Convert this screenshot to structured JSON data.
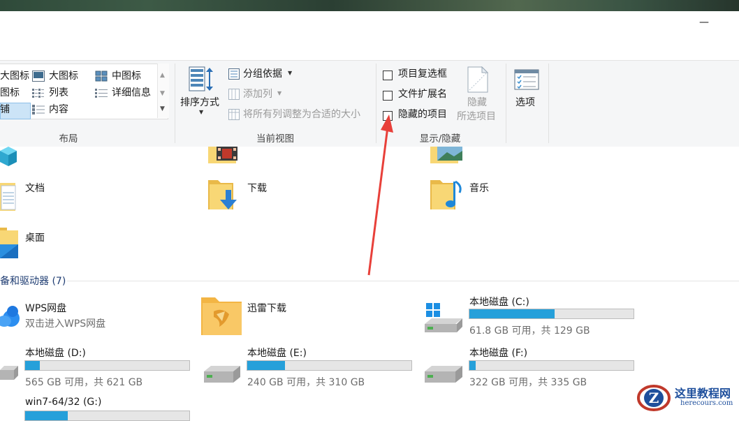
{
  "window": {
    "minimize_glyph": "—"
  },
  "ribbon": {
    "layout": {
      "label": "布局",
      "items": [
        "大图标",
        "大图标",
        "中图标",
        "图标",
        "列表",
        "详细信息",
        "铺",
        "内容"
      ]
    },
    "current_view": {
      "label": "当前视图",
      "sort_by": "排序方式",
      "group_by": "分组依据",
      "add_column": "添加列",
      "fit_columns": "将所有列调整为合适的大小"
    },
    "show_hide": {
      "label": "显示/隐藏",
      "checkboxes": [
        {
          "label": "项目复选框",
          "checked": false
        },
        {
          "label": "文件扩展名",
          "checked": false
        },
        {
          "label": "隐藏的项目",
          "checked": false
        }
      ],
      "hide_selected_line1": "隐藏",
      "hide_selected_line2": "所选项目"
    },
    "options": {
      "label": "选项"
    }
  },
  "folders": [
    {
      "name": "文档",
      "icon": "document-folder-icon"
    },
    {
      "name": "下载",
      "icon": "download-folder-icon"
    },
    {
      "name": "音乐",
      "icon": "music-folder-icon"
    },
    {
      "name": "桌面",
      "icon": "desktop-folder-icon"
    }
  ],
  "devices": {
    "header": "备和驱动器 (7)",
    "wps": {
      "name": "WPS网盘",
      "subtitle": "双击进入WPS网盘"
    },
    "xunlei": {
      "name": "迅雷下载"
    },
    "drives": [
      {
        "name": "本地磁盘 (C:)",
        "free": "61.8 GB 可用，共 129 GB",
        "used_fraction": 0.52
      },
      {
        "name": "本地磁盘 (D:)",
        "free": "565 GB 可用，共 621 GB",
        "used_fraction": 0.09
      },
      {
        "name": "本地磁盘 (E:)",
        "free": "240 GB 可用，共 310 GB",
        "used_fraction": 0.23
      },
      {
        "name": "本地磁盘 (F:)",
        "free": "322 GB 可用，共 335 GB",
        "used_fraction": 0.04
      },
      {
        "name": "win7-64/32 (G:)",
        "free": "",
        "used_fraction": 0.26
      }
    ]
  },
  "watermark": {
    "title": "这里教程网",
    "url": "herecours.com",
    "logo_letter": "Z"
  },
  "colors": {
    "accent": "#26a0da",
    "arrow": "#e8403a",
    "header": "#1e3c72"
  }
}
